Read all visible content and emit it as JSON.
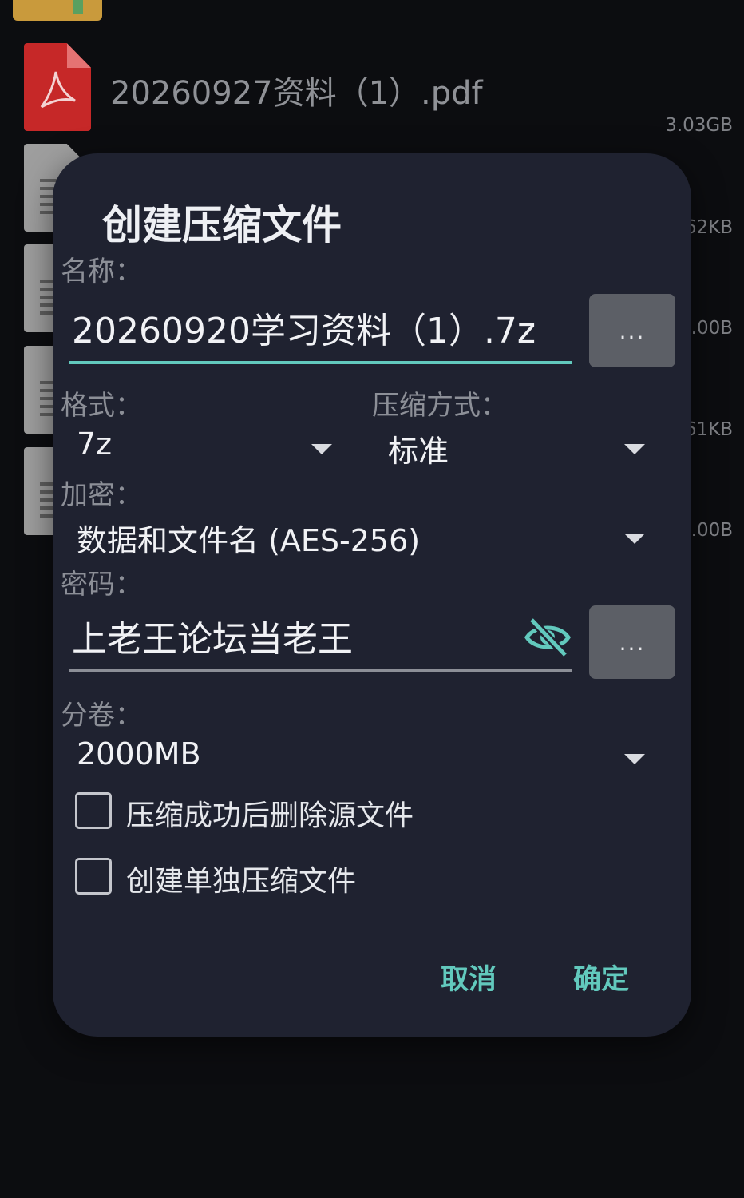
{
  "background": {
    "files": [
      {
        "name": "20260927资料（1）.pdf",
        "size": "3.03GB",
        "icon": "pdf-icon"
      },
      {
        "size": "62KB",
        "icon": "document-icon"
      },
      {
        "size": ".00B",
        "icon": "document-icon"
      },
      {
        "size": "61KB",
        "icon": "document-icon"
      },
      {
        "size": ".00B",
        "icon": "document-icon"
      }
    ]
  },
  "dialog": {
    "title": "创建压缩文件",
    "name_label": "名称：",
    "name_value": "20260920学习资料（1）.7z",
    "browse_label": "...",
    "format_label": "格式：",
    "format_value": "7z",
    "method_label": "压缩方式：",
    "method_value": "标准",
    "encryption_label": "加密：",
    "encryption_value": "数据和文件名 (AES-256)",
    "password_label": "密码：",
    "password_value": "上老王论坛当老王",
    "password_button_label": "...",
    "split_label": "分卷：",
    "split_value": "2000MB",
    "options": [
      {
        "label": "压缩成功后删除源文件",
        "checked": false
      },
      {
        "label": "创建单独压缩文件",
        "checked": false
      }
    ],
    "cancel_label": "取消",
    "ok_label": "确定"
  },
  "colors": {
    "accent": "#62c9bd",
    "dialog_bg": "#1f2230",
    "screen_bg": "#0c0d10"
  }
}
